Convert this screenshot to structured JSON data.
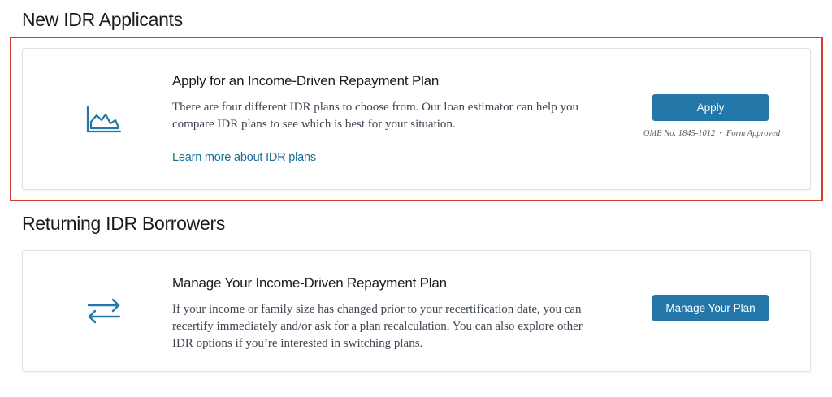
{
  "sections": {
    "new_applicants": {
      "heading": "New IDR Applicants",
      "card": {
        "icon": "line-chart-icon",
        "title": "Apply for an Income-Driven Repayment Plan",
        "description": "There are four different IDR plans to choose from. Our loan estimator can help you compare IDR plans to see which is best for your situation.",
        "link_text": "Learn more about IDR plans",
        "button_label": "Apply",
        "omb_number": "OMB No. 1845-1012",
        "omb_separator": "•",
        "omb_status": "Form Approved"
      }
    },
    "returning_borrowers": {
      "heading": "Returning IDR Borrowers",
      "card": {
        "icon": "swap-arrows-icon",
        "title": "Manage Your Income-Driven Repayment Plan",
        "description": "If your income or family size has changed prior to your recertification date, you can recertify immediately and/or ask for a plan recalculation. You can also explore other IDR options if you’re interested in switching plans.",
        "button_label": "Manage Your Plan"
      }
    }
  },
  "colors": {
    "accent": "#2378a9",
    "link": "#1a6f97",
    "highlight": "#d83933",
    "border": "#dfe1e2"
  }
}
